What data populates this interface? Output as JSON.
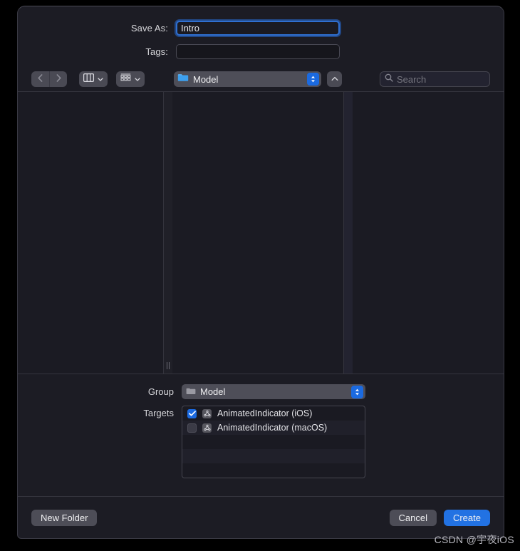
{
  "dialog": {
    "save_as_label": "Save As:",
    "save_as_value": "Intro",
    "tags_label": "Tags:",
    "tags_value": "",
    "tags_placeholder": ""
  },
  "toolbar": {
    "back_icon": "chevron-left",
    "forward_icon": "chevron-right",
    "column_view_icon": "column-view",
    "icon_view_icon": "gallery-view",
    "view_chevron": "⌄",
    "location_name": "Model",
    "location_icon": "blue-folder",
    "stepper_icon": "up-down-arrows",
    "up_button_icon": "chevron-up",
    "search_placeholder": "Search",
    "search_value": "",
    "search_icon": "magnifier"
  },
  "bottom": {
    "group_label": "Group",
    "group_value": "Model",
    "group_icon": "gray-folder",
    "targets_label": "Targets",
    "targets": [
      {
        "name": "AnimatedIndicator (iOS)",
        "checked": true,
        "icon": "xcode-target-icon"
      },
      {
        "name": "AnimatedIndicator (macOS)",
        "checked": false,
        "icon": "xcode-target-icon"
      }
    ]
  },
  "footer": {
    "new_folder_label": "New Folder",
    "cancel_label": "Cancel",
    "create_label": "Create"
  },
  "watermark": {
    "text": "CSDN @宇夜iOS"
  },
  "colors": {
    "accent_blue": "#2272e3",
    "stepper_blue": "#1b6ae0",
    "dialog_bg": "#1c1c24",
    "browser_bg": "#1b1b23",
    "control_gray": "#4a4a54"
  }
}
